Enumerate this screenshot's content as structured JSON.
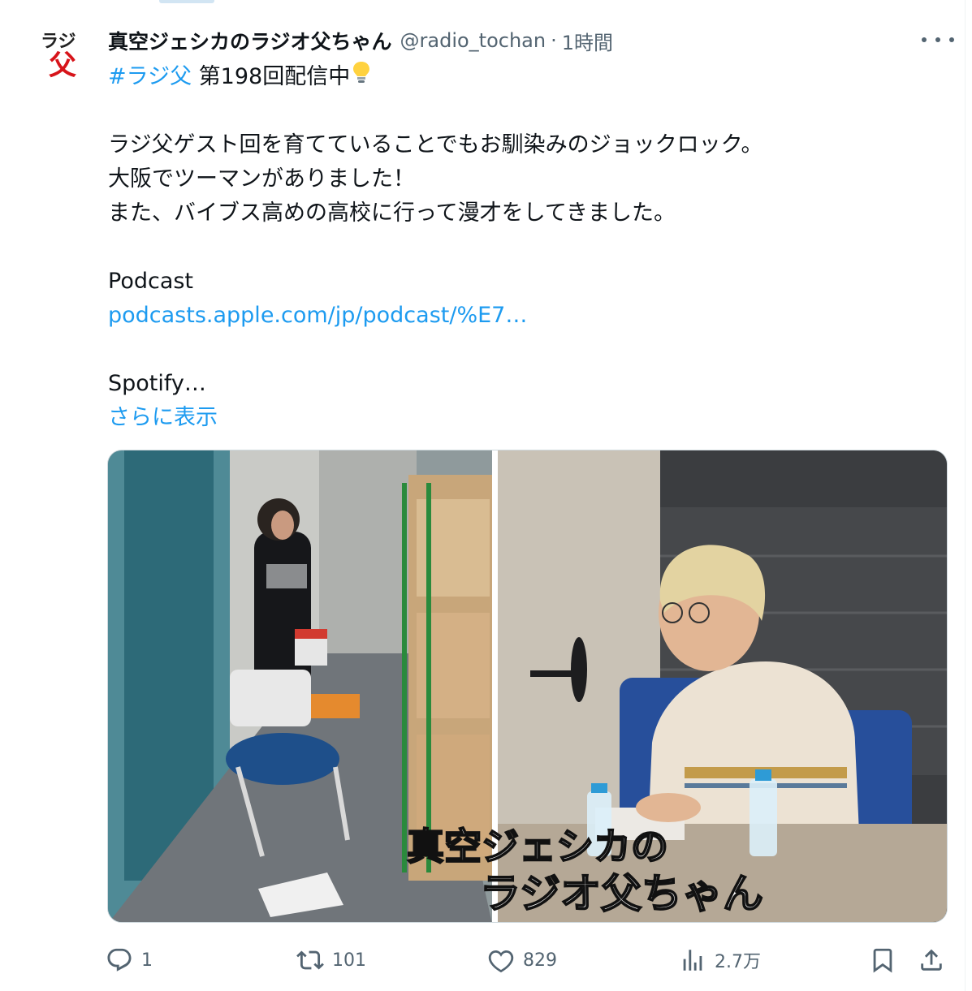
{
  "tweet": {
    "author_name": "真空ジェシカのラジオ父ちゃん",
    "handle": "@radio_tochan",
    "separator": "·",
    "time": "1時間",
    "hashtag": "#ラジ父",
    "headline": " 第198回配信中",
    "line1": "ラジ父ゲスト回を育てていることでもお馴染みのジョックロック。",
    "line2": "大阪でツーマンがありました！",
    "line3": "また、バイブス高めの高校に行って漫才をしてきました。",
    "podcast_label": "Podcast",
    "podcast_link": "podcasts.apple.com/jp/podcast/%E7…",
    "spotify_label": "Spotify…",
    "show_more": "さらに表示",
    "avatar_text": "ラジ父"
  },
  "media": {
    "logo_line1": "真空ジェシカの",
    "logo_line2": "ラジオ父ちゃん"
  },
  "actions": {
    "replies": "1",
    "retweets": "101",
    "likes": "829",
    "views": "2.7万"
  },
  "colors": {
    "link": "#1d9bf0",
    "text": "#0f1419",
    "secondary": "#536471",
    "avatar_red": "#d7141a"
  }
}
